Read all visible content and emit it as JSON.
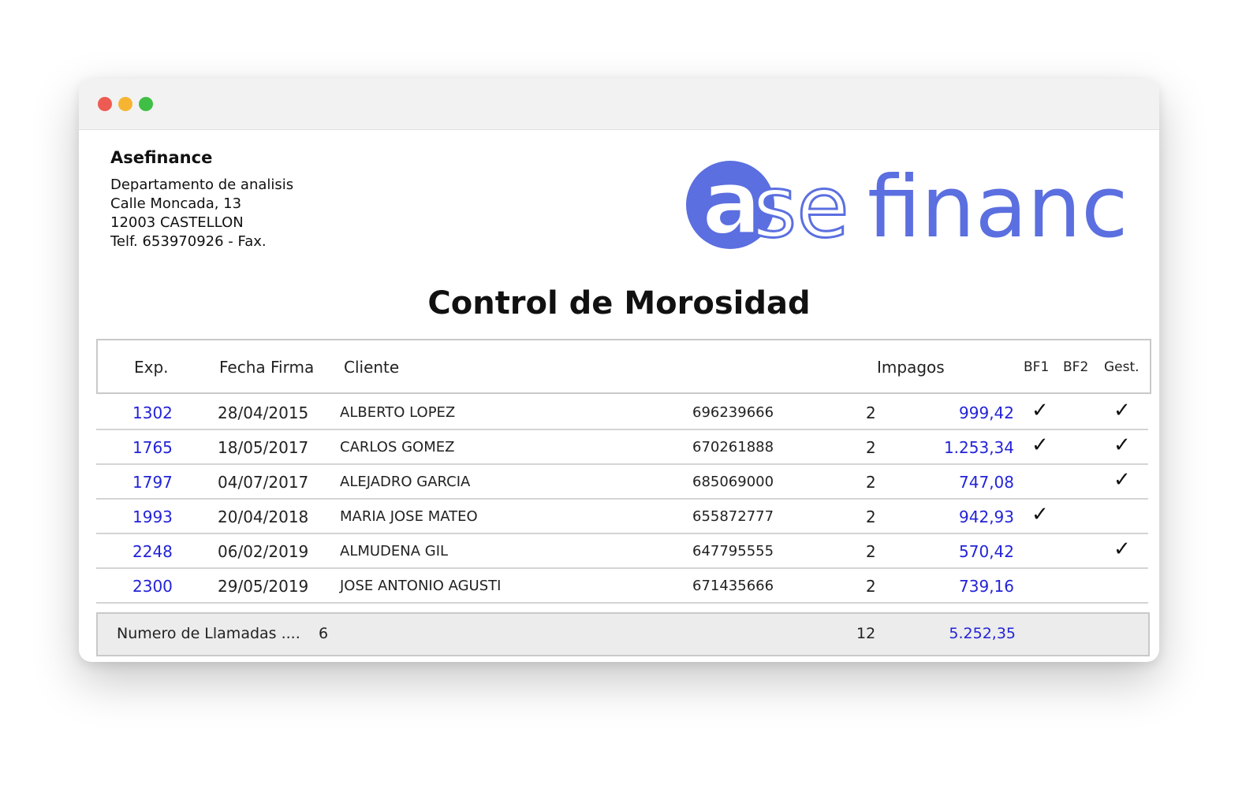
{
  "company": {
    "name": "Asefinance",
    "address_lines": [
      "Departamento de analisis",
      "Calle Moncada, 13",
      "12003 CASTELLON",
      "Telf. 653970926 - Fax."
    ]
  },
  "logo": {
    "text": "asefinance",
    "color": "#5b6fe0"
  },
  "report": {
    "title": "Control de Morosidad"
  },
  "table": {
    "headers": {
      "exp": "Exp.",
      "fecha": "Fecha Firma",
      "cliente": "Cliente",
      "impagos": "Impagos",
      "bf1": "BF1",
      "bf2": "BF2",
      "gest": "Gest."
    },
    "check_glyph": "✓",
    "rows": [
      {
        "exp": "1302",
        "fecha": "28/04/2015",
        "cliente": "ALBERTO LOPEZ",
        "telefono": "696239666",
        "impagos": "2",
        "importe": "999,42",
        "bf1": true,
        "bf2": false,
        "gest": true
      },
      {
        "exp": "1765",
        "fecha": "18/05/2017",
        "cliente": "CARLOS GOMEZ",
        "telefono": "670261888",
        "impagos": "2",
        "importe": "1.253,34",
        "bf1": true,
        "bf2": false,
        "gest": true
      },
      {
        "exp": "1797",
        "fecha": "04/07/2017",
        "cliente": "ALEJADRO GARCIA",
        "telefono": "685069000",
        "impagos": "2",
        "importe": "747,08",
        "bf1": false,
        "bf2": false,
        "gest": true
      },
      {
        "exp": "1993",
        "fecha": "20/04/2018",
        "cliente": "MARIA JOSE MATEO",
        "telefono": "655872777",
        "impagos": "2",
        "importe": "942,93",
        "bf1": true,
        "bf2": false,
        "gest": false
      },
      {
        "exp": "2248",
        "fecha": "06/02/2019",
        "cliente": "ALMUDENA GIL",
        "telefono": "647795555",
        "impagos": "2",
        "importe": "570,42",
        "bf1": false,
        "bf2": false,
        "gest": true
      },
      {
        "exp": "2300",
        "fecha": "29/05/2019",
        "cliente": "JOSE ANTONIO AGUSTI",
        "telefono": "671435666",
        "impagos": "2",
        "importe": "739,16",
        "bf1": false,
        "bf2": false,
        "gest": false
      }
    ]
  },
  "footer": {
    "label": "Numero de Llamadas ....",
    "count": "6",
    "total_impagos": "12",
    "total_importe": "5.252,35"
  },
  "colors": {
    "link_blue": "#2323d8",
    "logo_blue": "#5b6fe0"
  }
}
